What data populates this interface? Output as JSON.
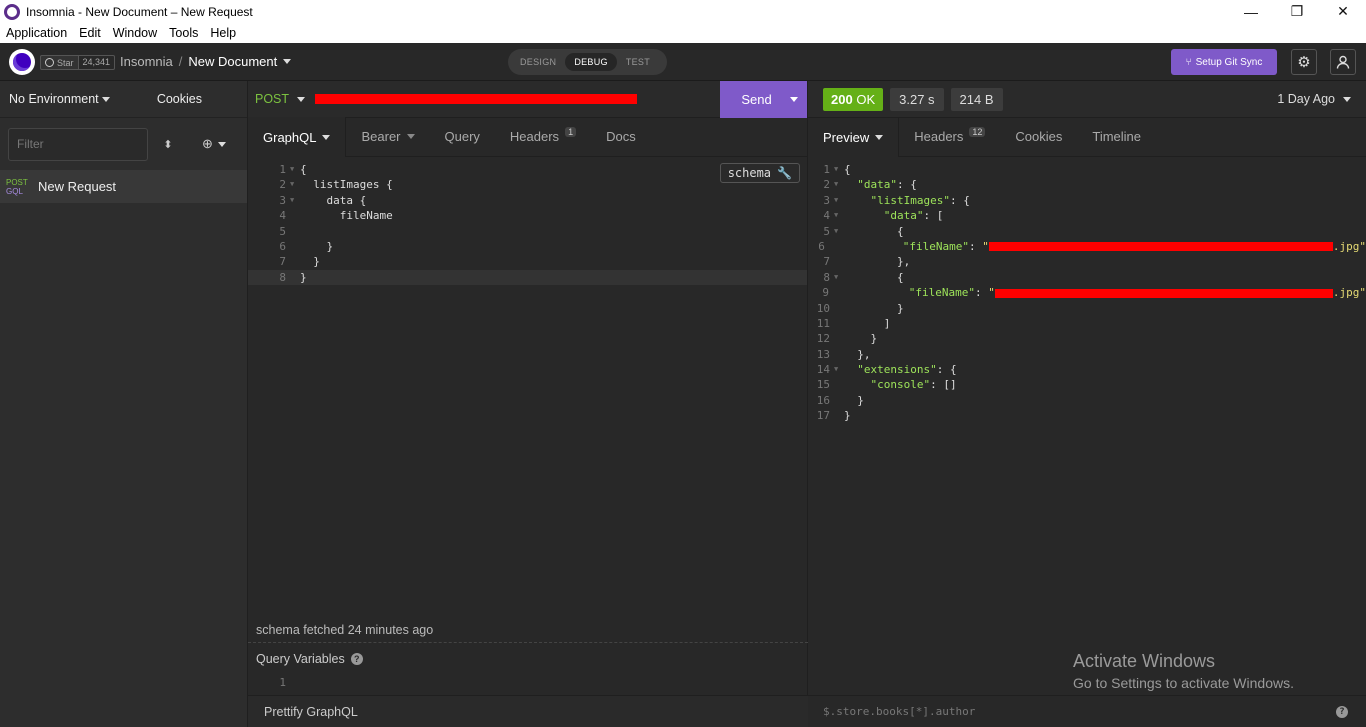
{
  "window": {
    "title": "Insomnia - New Document – New Request",
    "controls": [
      "—",
      "❐",
      "✕"
    ]
  },
  "menu": [
    "Application",
    "Edit",
    "Window",
    "Tools",
    "Help"
  ],
  "header": {
    "github_star_label": "Star",
    "github_star_count": "24,341",
    "breadcrumb_project": "Insomnia",
    "breadcrumb_separator": "/",
    "breadcrumb_document": "New Document",
    "modes": [
      "DESIGN",
      "DEBUG",
      "TEST"
    ],
    "active_mode": "DEBUG",
    "git_sync_label": "Setup Git Sync",
    "accent_color": "#7f5ac9"
  },
  "sidebar": {
    "environment_label": "No Environment",
    "cookies_label": "Cookies",
    "filter_placeholder": "Filter",
    "requests": [
      {
        "method": "POST",
        "type": "GQL",
        "name": "New Request"
      }
    ]
  },
  "request": {
    "method": "POST",
    "send_label": "Send",
    "tabs": [
      {
        "label": "GraphQL",
        "active": true
      },
      {
        "label": "Bearer"
      },
      {
        "label": "Query"
      },
      {
        "label": "Headers",
        "badge": "1"
      },
      {
        "label": "Docs"
      }
    ],
    "schema_button_label": "schema",
    "query_lines": [
      "{",
      "  listImages {",
      "    data {",
      "      fileName",
      "",
      "    }",
      "  }",
      "}"
    ],
    "schema_fetched_text": "schema fetched 24 minutes ago",
    "query_variables_label": "Query Variables",
    "query_variables_line_number": "1",
    "prettify_label": "Prettify GraphQL"
  },
  "response": {
    "status": "200",
    "status_text": "OK",
    "time": "3.27 s",
    "size": "214 B",
    "age": "1 Day Ago",
    "status_color": "#65b017",
    "tabs": [
      {
        "label": "Preview",
        "active": true
      },
      {
        "label": "Headers",
        "badge": "12"
      },
      {
        "label": "Cookies"
      },
      {
        "label": "Timeline"
      }
    ],
    "filter_placeholder": "$.store.books[*].author",
    "line_count": 17
  },
  "watermark": {
    "line1": "Activate Windows",
    "line2": "Go to Settings to activate Windows."
  }
}
